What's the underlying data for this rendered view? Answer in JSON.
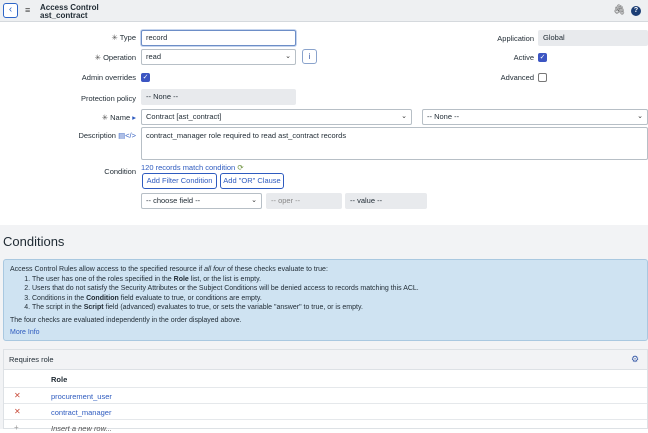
{
  "header": {
    "title_line1": "Access Control",
    "title_line2": "ast_contract",
    "back_icon": "chevron-left-icon",
    "menu_icon": "hamburger-icon",
    "attach_icon": "paperclip-icon",
    "help_icon": "help-circle-icon"
  },
  "form": {
    "type_label": "Type",
    "type_value": "record",
    "operation_label": "Operation",
    "operation_value": "read",
    "admin_overrides_label": "Admin overrides",
    "admin_overrides_checked": true,
    "protection_policy_label": "Protection policy",
    "protection_policy_value": "-- None --",
    "name_label": "Name",
    "name_table_value": "Contract [ast_contract]",
    "name_field_value": "-- None --",
    "description_label": "Description",
    "description_value": "contract_manager role required to read ast_contract records",
    "condition_label": "Condition",
    "records_match": "120 records match condition",
    "add_filter_button": "Add Filter Condition",
    "add_or_button": "Add \"OR\" Clause",
    "choose_field": "-- choose field --",
    "oper": "-- oper --",
    "value": "-- value --",
    "application_label": "Application",
    "application_value": "Global",
    "active_label": "Active",
    "active_checked": true,
    "advanced_label": "Advanced",
    "advanced_checked": false,
    "required_marker": "✳",
    "caret": "⌄",
    "info_icon": "i"
  },
  "conditions": {
    "heading": "Conditions",
    "intro_pre": "Access Control Rules allow access to the specified resource if ",
    "intro_em": "all four",
    "intro_post": " of these checks evaluate to true:",
    "items": [
      {
        "pre": "The user has one of the roles specified in the ",
        "bold": "Role",
        "post": " list, or the list is empty."
      },
      {
        "pre": "Users that do not satisfy the Security Attributes or the Subject Conditions will be denied access to records matching this ACL.",
        "bold": "",
        "post": ""
      },
      {
        "pre": "Conditions in the ",
        "bold": "Condition",
        "post": " field evaluate to true, or conditions are empty."
      },
      {
        "pre": "The script in the ",
        "bold": "Script",
        "post": " field (advanced) evaluates to true, or sets the variable \"answer\" to true, or is empty."
      }
    ],
    "footer": "The four checks are evaluated independently in the order displayed above.",
    "more_info": "More Info"
  },
  "requires_role": {
    "title": "Requires role",
    "column": "Role",
    "rows": [
      "procurement_user",
      "contract_manager"
    ],
    "insert_row": "Insert a new row...",
    "settings_icon": "gear-icon",
    "delete_icon": "x-icon"
  }
}
